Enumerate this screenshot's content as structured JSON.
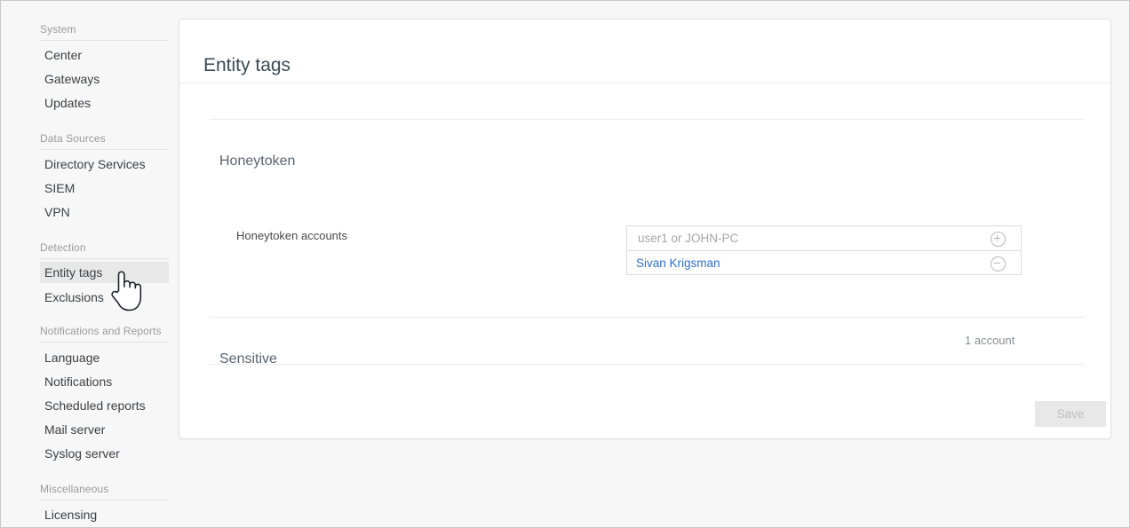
{
  "sidebar": {
    "groups": [
      {
        "label": "System",
        "items": [
          {
            "label": "Center"
          },
          {
            "label": "Gateways"
          },
          {
            "label": "Updates"
          }
        ]
      },
      {
        "label": "Data Sources",
        "items": [
          {
            "label": "Directory Services"
          },
          {
            "label": "SIEM"
          },
          {
            "label": "VPN"
          }
        ]
      },
      {
        "label": "Detection",
        "items": [
          {
            "label": "Entity tags"
          },
          {
            "label": "Exclusions"
          }
        ]
      },
      {
        "label": "Notifications and Reports",
        "items": [
          {
            "label": "Language"
          },
          {
            "label": "Notifications"
          },
          {
            "label": "Scheduled reports"
          },
          {
            "label": "Mail server"
          },
          {
            "label": "Syslog server"
          }
        ]
      },
      {
        "label": "Miscellaneous",
        "items": [
          {
            "label": "Licensing"
          }
        ]
      }
    ]
  },
  "page": {
    "title": "Entity tags"
  },
  "honeytoken": {
    "title": "Honeytoken",
    "collapse_icon": "chevron-up-icon",
    "field_label": "Honeytoken accounts",
    "input_placeholder": "user1 or JOHN-PC",
    "input_value": "",
    "add_icon": "circle-plus-icon",
    "remove_icon": "circle-minus-icon",
    "accounts": [
      {
        "name": "Sivan Krigsman"
      }
    ]
  },
  "sensitive": {
    "title": "Sensitive",
    "count_text": "1 account",
    "expand_icon": "chevron-down-icon"
  },
  "actions": {
    "save_label": "Save"
  },
  "cursor": {
    "icon": "pointing-hand-cursor"
  },
  "colors": {
    "link_blue": "#2f6fd0",
    "selected_nav": "#e8e8e8",
    "save_disabled_bg": "#e8e8e8"
  }
}
